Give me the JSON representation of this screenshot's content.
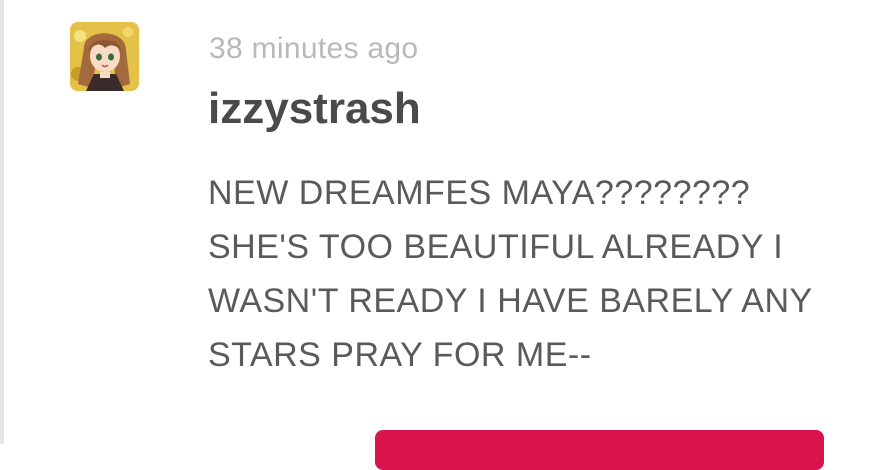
{
  "post": {
    "timestamp": "38 minutes ago",
    "username": "izzystrash",
    "message_lines": [
      "NEW DREAMFES MAYA????????",
      "SHE'S TOO BEAUTIFUL ALREADY I",
      "WASN'T READY I HAVE BARELY ANY",
      "STARS PRAY FOR ME--"
    ]
  },
  "colors": {
    "accent_button": "#d9134c",
    "username_text": "#4a4a4a",
    "timestamp_text": "#b9b9b9",
    "message_text": "#5a5a5a"
  },
  "icons": {
    "avatar": "user-avatar-image"
  }
}
